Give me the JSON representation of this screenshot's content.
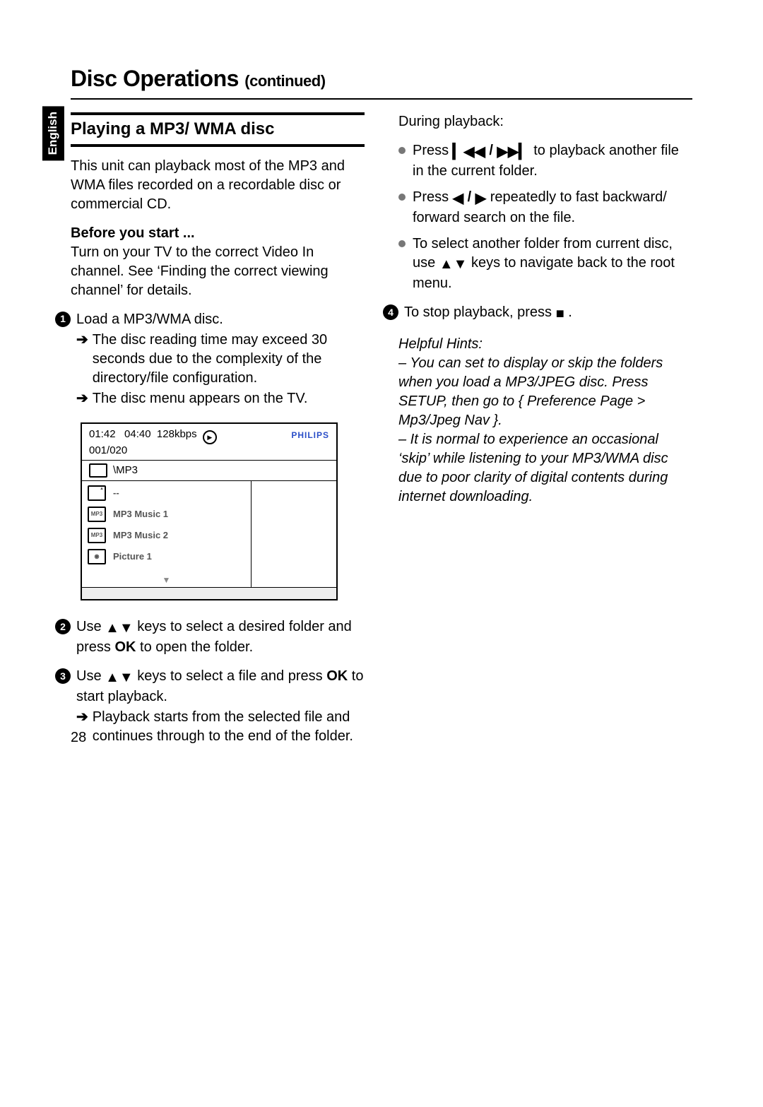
{
  "language_tab": "English",
  "page_number": "28",
  "title_main": "Disc Operations",
  "title_cont": "(continued)",
  "section_heading": "Playing a MP3/ WMA disc",
  "intro": "This unit can playback most of the MP3 and WMA files recorded on a recordable disc or commercial CD.",
  "before_title": "Before you start ...",
  "before_body": "Turn on your TV to the correct Video In channel. See ‘Finding the correct viewing channel’ for details.",
  "step1_text": "Load a MP3/WMA disc.",
  "step1_sub1": "The disc reading time may exceed 30 seconds due to the complexity of the directory/file configuration.",
  "step1_sub2": "The disc menu appears on the TV.",
  "menu": {
    "time_line": "01:42   04:40  128kbps",
    "track_line": "001/020",
    "brand": "PHILIPS",
    "path": "\\MP3",
    "items": [
      {
        "icon": "up",
        "label": "--"
      },
      {
        "icon": "mp3",
        "label": "MP3 Music 1"
      },
      {
        "icon": "mp3",
        "label": "MP3 Music 2"
      },
      {
        "icon": "pic",
        "label": "Picture 1"
      }
    ]
  },
  "step2_pre": "Use ",
  "step2_post": " keys to select a desired folder and press ",
  "step2_ok": "OK",
  "step2_tail": " to open the folder.",
  "step3_pre": "Use ",
  "step3_post": " keys to select a file and press ",
  "step3_ok": "OK",
  "step3_tail": " to start playback.",
  "step3_sub": "Playback starts from the selected file and continues through to the end of the folder.",
  "right": {
    "during": "During playback:",
    "b1_pre": "Press  ",
    "b1_post": "  to playback another file in the current folder.",
    "b2_pre": "Press ",
    "b2_post": " repeatedly to fast backward/ forward search on the file.",
    "b3_pre": "To select another folder from current disc, use ",
    "b3_post": " keys to navigate back to the root menu.",
    "step4_pre": "To stop playback, press ",
    "step4_post": ".",
    "hints_title": "Helpful Hints:",
    "hint1": "–  You can set to display or skip the folders when you load a MP3/JPEG disc. Press SETUP, then go to { Preference Page > Mp3/Jpeg Nav }.",
    "hint2": "–  It is normal to experience an occasional ‘skip’ while listening to your MP3/WMA disc due to poor clarity of digital contents during internet downloading."
  }
}
